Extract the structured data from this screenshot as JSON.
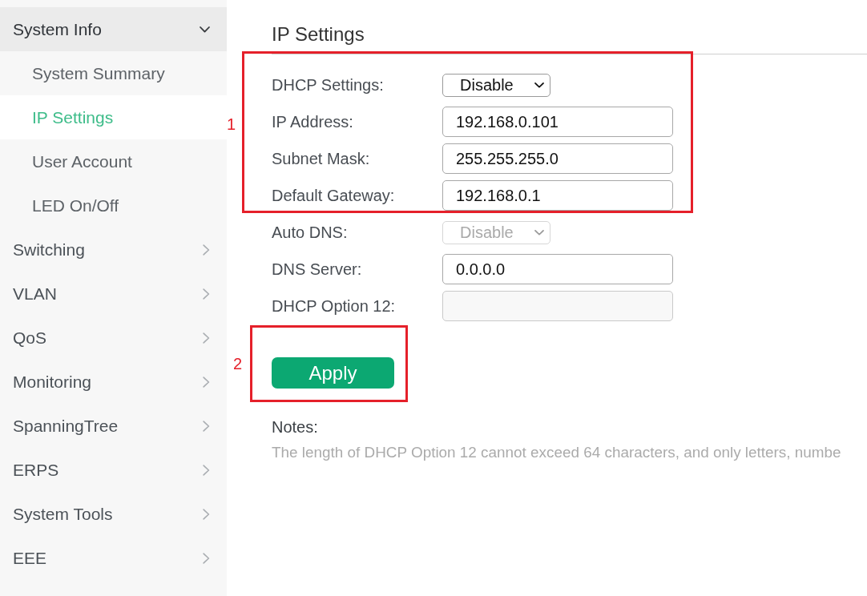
{
  "sidebar": {
    "items": [
      {
        "label": "System Info",
        "expanded": true,
        "children": [
          {
            "label": "System Summary",
            "selected": false
          },
          {
            "label": "IP Settings",
            "selected": true
          },
          {
            "label": "User Account",
            "selected": false
          },
          {
            "label": "LED On/Off",
            "selected": false
          }
        ]
      },
      {
        "label": "Switching",
        "expanded": false
      },
      {
        "label": "VLAN",
        "expanded": false
      },
      {
        "label": "QoS",
        "expanded": false
      },
      {
        "label": "Monitoring",
        "expanded": false
      },
      {
        "label": "SpanningTree",
        "expanded": false
      },
      {
        "label": "ERPS",
        "expanded": false
      },
      {
        "label": "System Tools",
        "expanded": false
      },
      {
        "label": "EEE",
        "expanded": false
      }
    ]
  },
  "page": {
    "title": "IP Settings",
    "sections": [
      {
        "annotation": "1",
        "fields": [
          {
            "kind": "select",
            "label": "DHCP Settings:",
            "value": "Disable",
            "disabled": false
          },
          {
            "kind": "text",
            "label": "IP Address:",
            "value": "192.168.0.101",
            "disabled": false
          },
          {
            "kind": "text",
            "label": "Subnet Mask:",
            "value": "255.255.255.0",
            "disabled": false
          },
          {
            "kind": "text",
            "label": "Default Gateway:",
            "value": "192.168.0.1",
            "disabled": false
          }
        ]
      },
      {
        "fields": [
          {
            "kind": "select",
            "label": "Auto DNS:",
            "value": "Disable",
            "disabled": true
          },
          {
            "kind": "text",
            "label": "DNS Server:",
            "value": "0.0.0.0",
            "disabled": false
          },
          {
            "kind": "text",
            "label": "DHCP Option 12:",
            "disabled": true
          }
        ]
      }
    ],
    "apply_button": {
      "label": "Apply",
      "annotation": "2"
    },
    "notes": {
      "title": "Notes:",
      "text": "The length of DHCP Option 12 cannot exceed 64 characters, and only letters, numbe"
    }
  }
}
